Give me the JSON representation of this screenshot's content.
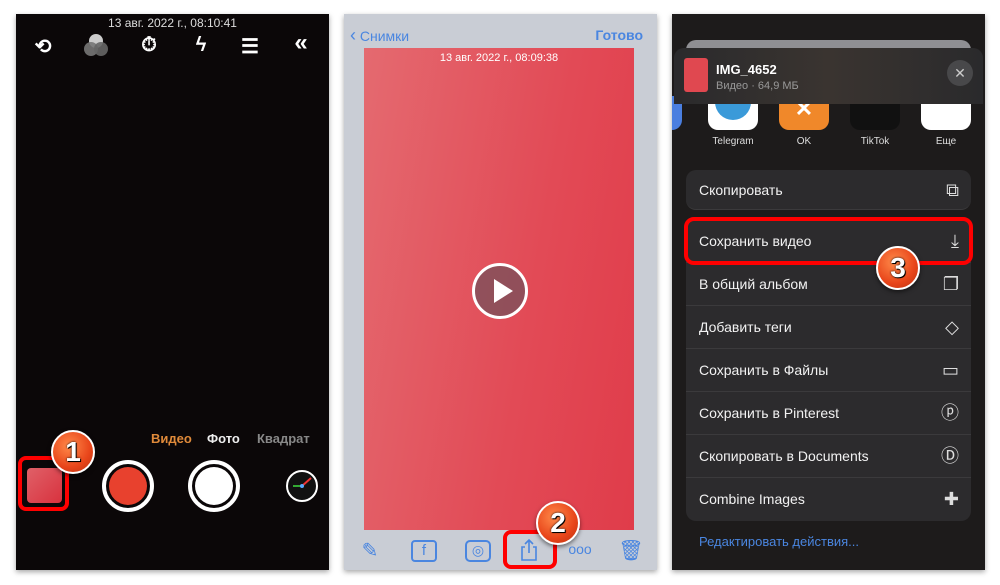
{
  "camera": {
    "timestamp": "13 авг. 2022 г., 08:10:41",
    "icons": [
      "camera-switch-icon",
      "filters-icon",
      "timer-off-icon",
      "flash-auto-icon",
      "menu-list-icon",
      "collapse-chevrons-icon"
    ],
    "modes": [
      "Видео",
      "Фото",
      "Квадрат"
    ],
    "active_mode": "Видео",
    "badge": "1",
    "accent": "#e08a3a"
  },
  "viewer": {
    "back_label": "Снимки",
    "done_label": "Готово",
    "timestamp": "13 авг. 2022 г., 08:09:38",
    "toolbar": [
      "pencil-icon",
      "facebook-icon",
      "instagram-icon",
      "share-icon",
      "more-icon",
      "trash-icon"
    ],
    "badge": "2",
    "accent": "#4a86e0"
  },
  "share": {
    "file_name": "IMG_4652",
    "file_info": "Видео · 64,9 МБ",
    "apps": [
      "Telegram",
      "OK",
      "TikTok",
      "Еще"
    ],
    "copy_label": "Скопировать",
    "actions": [
      {
        "label": "Сохранить видео",
        "icon": "save-download-icon"
      },
      {
        "label": "В общий альбом",
        "icon": "shared-album-icon"
      },
      {
        "label": "Добавить теги",
        "icon": "tag-icon"
      },
      {
        "label": "Сохранить в Файлы",
        "icon": "folder-icon"
      },
      {
        "label": "Сохранить в Pinterest",
        "icon": "pinterest-icon"
      },
      {
        "label": "Скопировать в Documents",
        "icon": "documents-icon"
      },
      {
        "label": "Combine Images",
        "icon": "puzzle-icon"
      }
    ],
    "edit_actions": "Редактировать действия...",
    "badge": "3"
  }
}
